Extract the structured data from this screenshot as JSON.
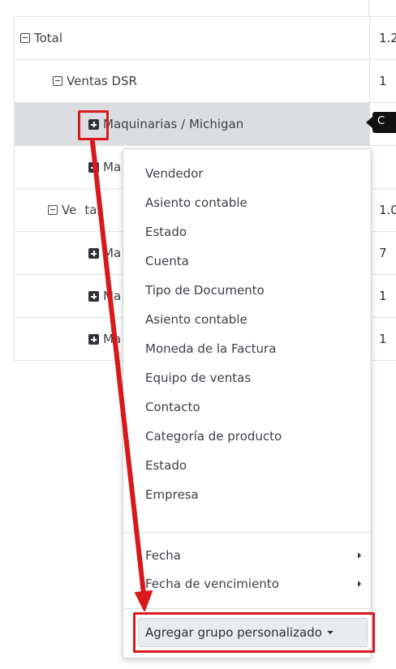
{
  "pivot": {
    "rows": [
      {
        "label": "Total",
        "icon": "collapse",
        "value": "1.2"
      },
      {
        "label": "Ventas DSR",
        "icon": "collapse",
        "value": "1"
      },
      {
        "label": "Maquinarias / Michigan",
        "icon": "expand",
        "value": ""
      },
      {
        "label": "Ma",
        "icon": "expand",
        "value": ""
      },
      {
        "label": "Ve",
        "label_tail": "tas",
        "icon": "collapse",
        "value": "1.0"
      },
      {
        "label": "Ma",
        "icon": "expand",
        "value": "7"
      },
      {
        "label": "Ma",
        "icon": "expand",
        "value": "1"
      },
      {
        "label": "Ma",
        "icon": "expand",
        "value": "1"
      }
    ]
  },
  "tooltip": {
    "text": "C"
  },
  "groupby_menu": {
    "items": [
      "Vendedor",
      "Asiento contable",
      "Estado",
      "Cuenta",
      "Tipo de Documento",
      "Asiento contable",
      "Moneda de la Factura",
      "Equipo de ventas",
      "Contacto",
      "Categoría de producto",
      "Estado",
      "Empresa"
    ],
    "date_items": [
      "Fecha",
      "Fecha de vencimiento"
    ],
    "custom_group_label": "Agregar grupo personalizado"
  },
  "annotation": {
    "color": "#d7191c"
  }
}
